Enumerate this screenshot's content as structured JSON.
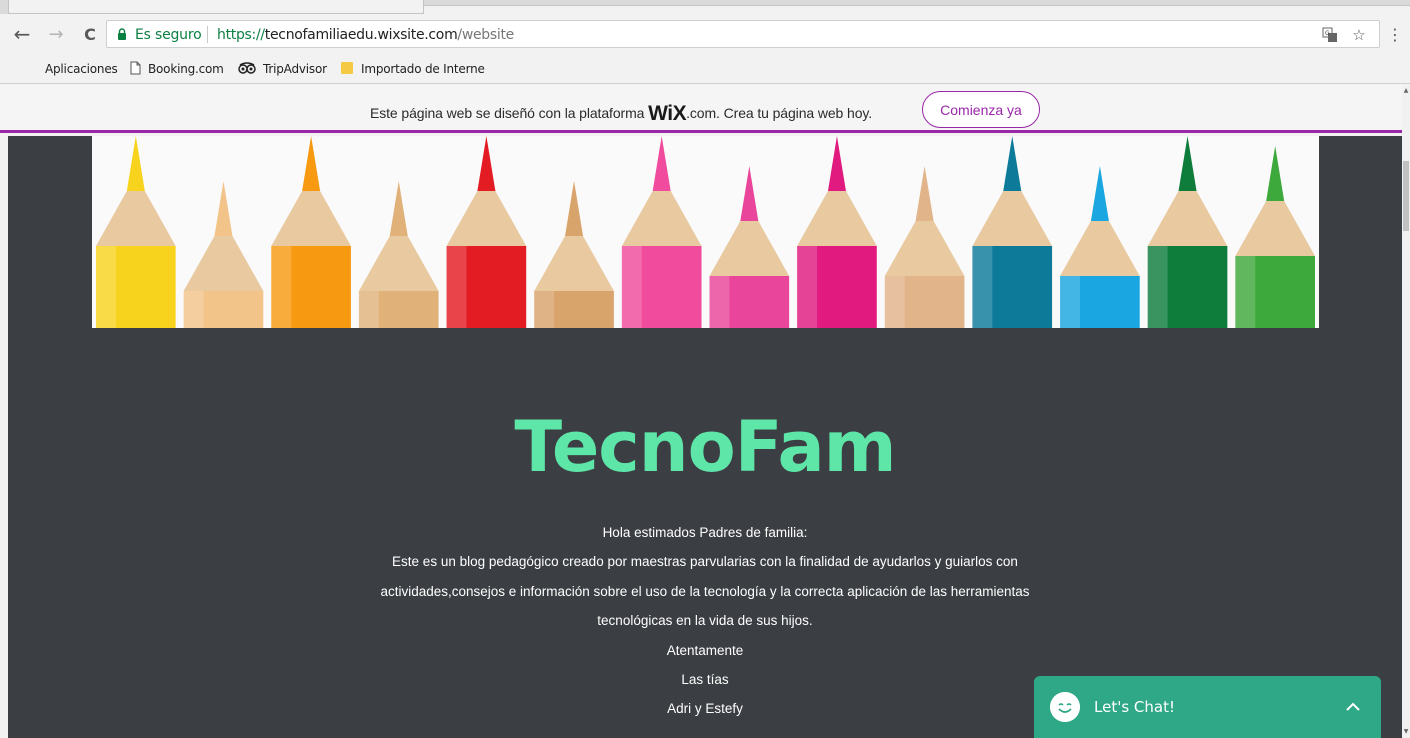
{
  "browser": {
    "secure_label": "Es seguro",
    "url_scheme": "https://",
    "url_host": "tecnofamiliaedu.wixsite.com",
    "url_path": "/website",
    "menu_glyph": "⋮",
    "star_glyph": "☆",
    "back_glyph": "←",
    "forward_glyph": "→",
    "reload_glyph": "C",
    "icons": [
      "back-icon",
      "forward-icon",
      "reload-icon",
      "lock-icon",
      "translate-icon",
      "star-icon",
      "menu-icon"
    ]
  },
  "bookmarks": [
    {
      "label": "Aplicaciones",
      "icon": "apps-grid-icon"
    },
    {
      "label": "Booking.com",
      "icon": "page-icon"
    },
    {
      "label": "TripAdvisor",
      "icon": "tripadvisor-icon"
    },
    {
      "label": "Importado de Interne",
      "icon": "folder-icon"
    }
  ],
  "wix_banner": {
    "text_before": "Este página web se diseñó con la plataforma ",
    "logo_wix": "WiX",
    "logo_com": ".com",
    "text_after": ". Crea tu página web hoy.",
    "button_label": "Comienza ya",
    "accent": "#9a27a8"
  },
  "page": {
    "background": "#3b3e43",
    "title": "TecnoFam",
    "title_color": "#5ee6a9",
    "body_lines": [
      "Hola estimados Padres de familia:",
      "Este es un blog pedagógico creado por maestras parvularias con la finalidad de ayudarlos y guiarlos con",
      "actividades,consejos e información sobre el uso de la tecnología y la correcta aplicación de las herramientas",
      "tecnológicas en la vida de sus hijos.",
      "Atentamente",
      "Las tías",
      "Adri y Estefy"
    ],
    "pencil_colors": [
      "#f7d31e",
      "#f2c48a",
      "#f79a12",
      "#e0b27a",
      "#e31b23",
      "#d9a36c",
      "#f04b9c",
      "#e9459a",
      "#e01a7f",
      "#e2b48a",
      "#0d7a99",
      "#1aa6e0",
      "#0e7d3c",
      "#3da83b"
    ]
  },
  "chat": {
    "label": "Let's Chat!",
    "color": "#2fa887"
  }
}
